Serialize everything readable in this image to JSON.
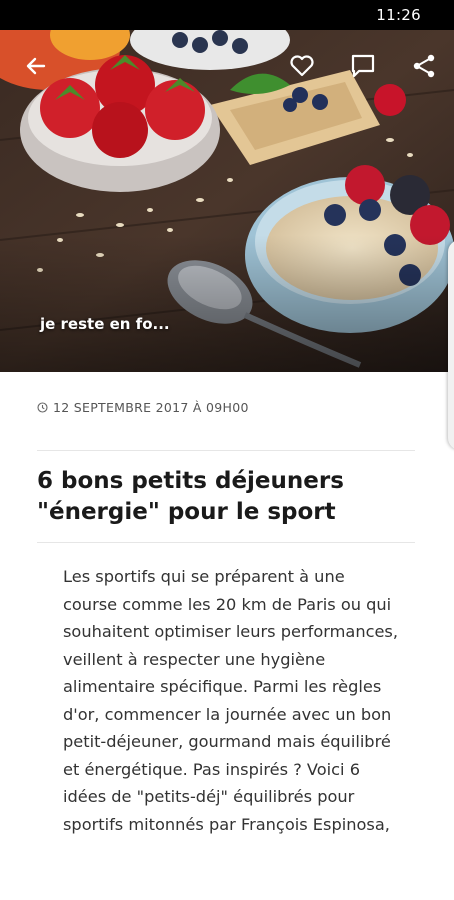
{
  "status_bar": {
    "time": "11:26"
  },
  "hero": {
    "caption": "je reste en fo..."
  },
  "toolbar": {
    "back_icon": "arrow-left-icon",
    "favorite_icon": "heart-icon",
    "comment_icon": "comment-icon",
    "share_icon": "share-icon"
  },
  "article": {
    "date": "12 SEPTEMBRE 2017 À 09H00",
    "title": "6 bons petits déjeuners \"énergie\" pour le sport",
    "intro": "Les sportifs qui se préparent à une course comme les 20 km de Paris ou qui souhaitent optimiser leurs performances, veillent à respecter une hygiène alimentaire spécifique. Parmi les règles d'or, commencer la journée avec un bon petit-déjeuner, gourmand mais équilibré et énergétique. Pas inspirés ? Voici 6 idées de \"petits-déj\" équilibrés pour sportifs mitonnés par François Espinosa,"
  },
  "colors": {
    "status_bar": "#000000",
    "text_primary": "#1a1a1a",
    "text_body": "#333333",
    "text_meta": "#555555"
  }
}
